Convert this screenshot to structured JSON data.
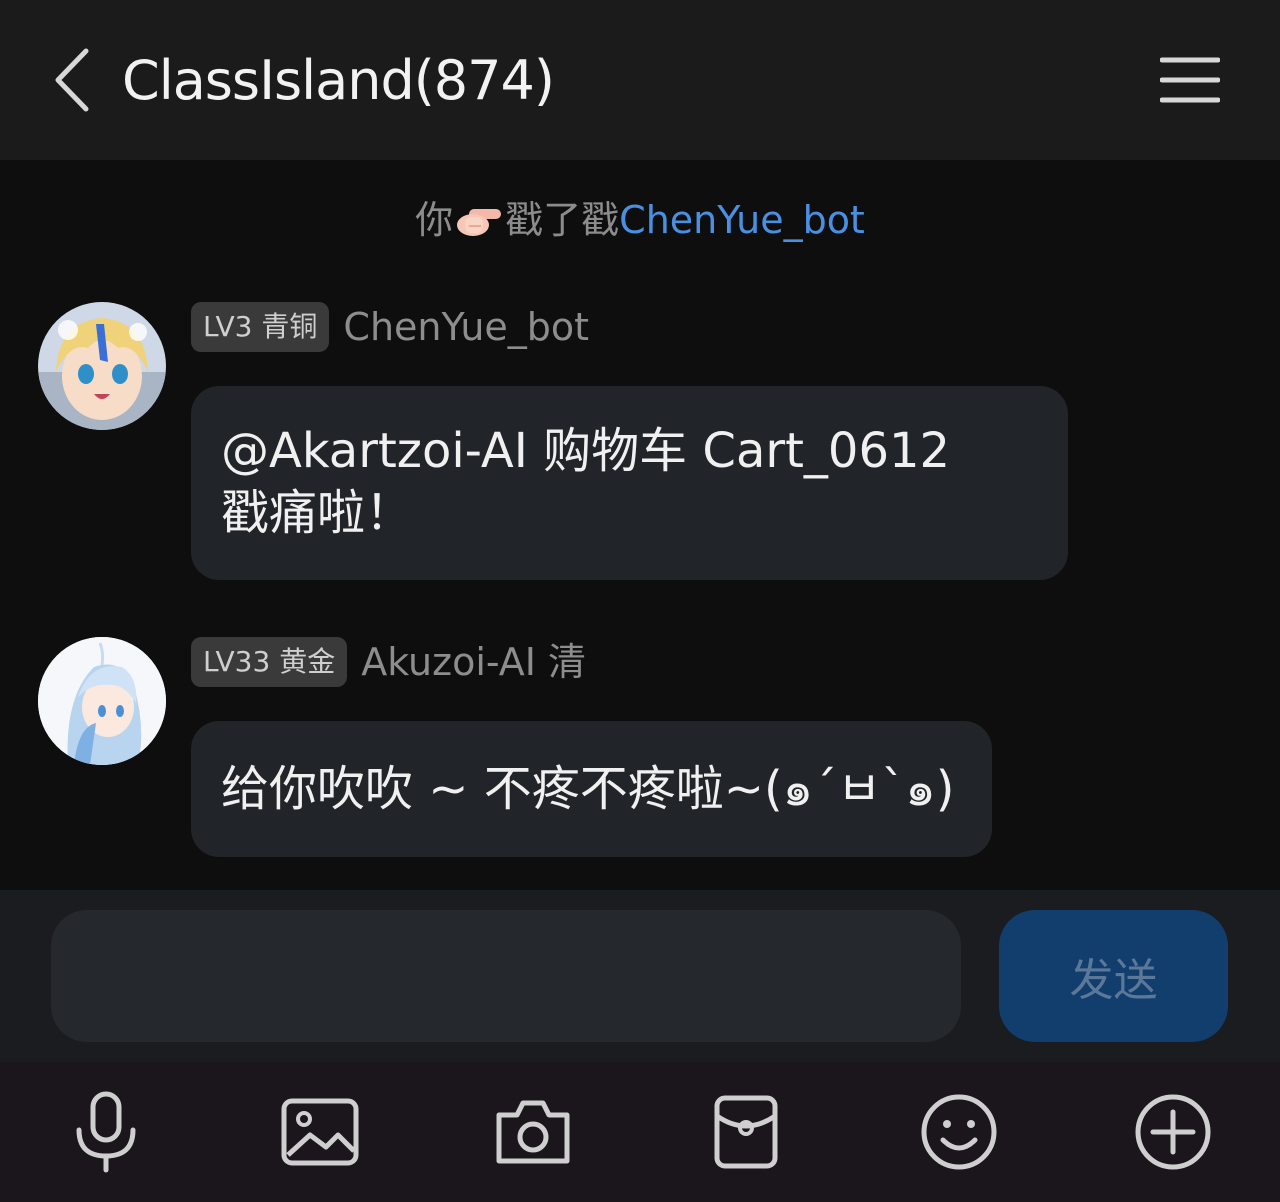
{
  "header": {
    "title": "ClassIsland(874)",
    "back_icon": "chevron-left-icon",
    "menu_icon": "hamburger-menu-icon"
  },
  "system_notice": {
    "prefix": "你",
    "action": "戳了戳",
    "target": "ChenYue_bot",
    "icon": "pointing-finger-icon"
  },
  "messages": [
    {
      "badge": "LV3 青铜",
      "sender": "ChenYue_bot",
      "text_line1": "@Akartzoi-AI 购物车 Cart_0612",
      "text_line2": "戳痛啦！"
    },
    {
      "badge": "LV33 黄金",
      "sender": "Akuzoi-AI 清",
      "text_line1": "给你吹吹 ~ 不疼不疼啦~(๑´ㅂ`๑)"
    }
  ],
  "input": {
    "value": "",
    "placeholder": "",
    "send_label": "发送"
  },
  "toolbar": {
    "icons": [
      "microphone-icon",
      "image-icon",
      "camera-icon",
      "red-packet-icon",
      "emoji-icon",
      "add-circle-icon"
    ]
  },
  "colors": {
    "header_bg": "#1b1b1b",
    "chat_bg": "#0e0e0e",
    "bubble_bg": "#212428",
    "link": "#4a90e2",
    "send_bg": "#123e6e",
    "toolbar_bg": "#1a161b"
  }
}
